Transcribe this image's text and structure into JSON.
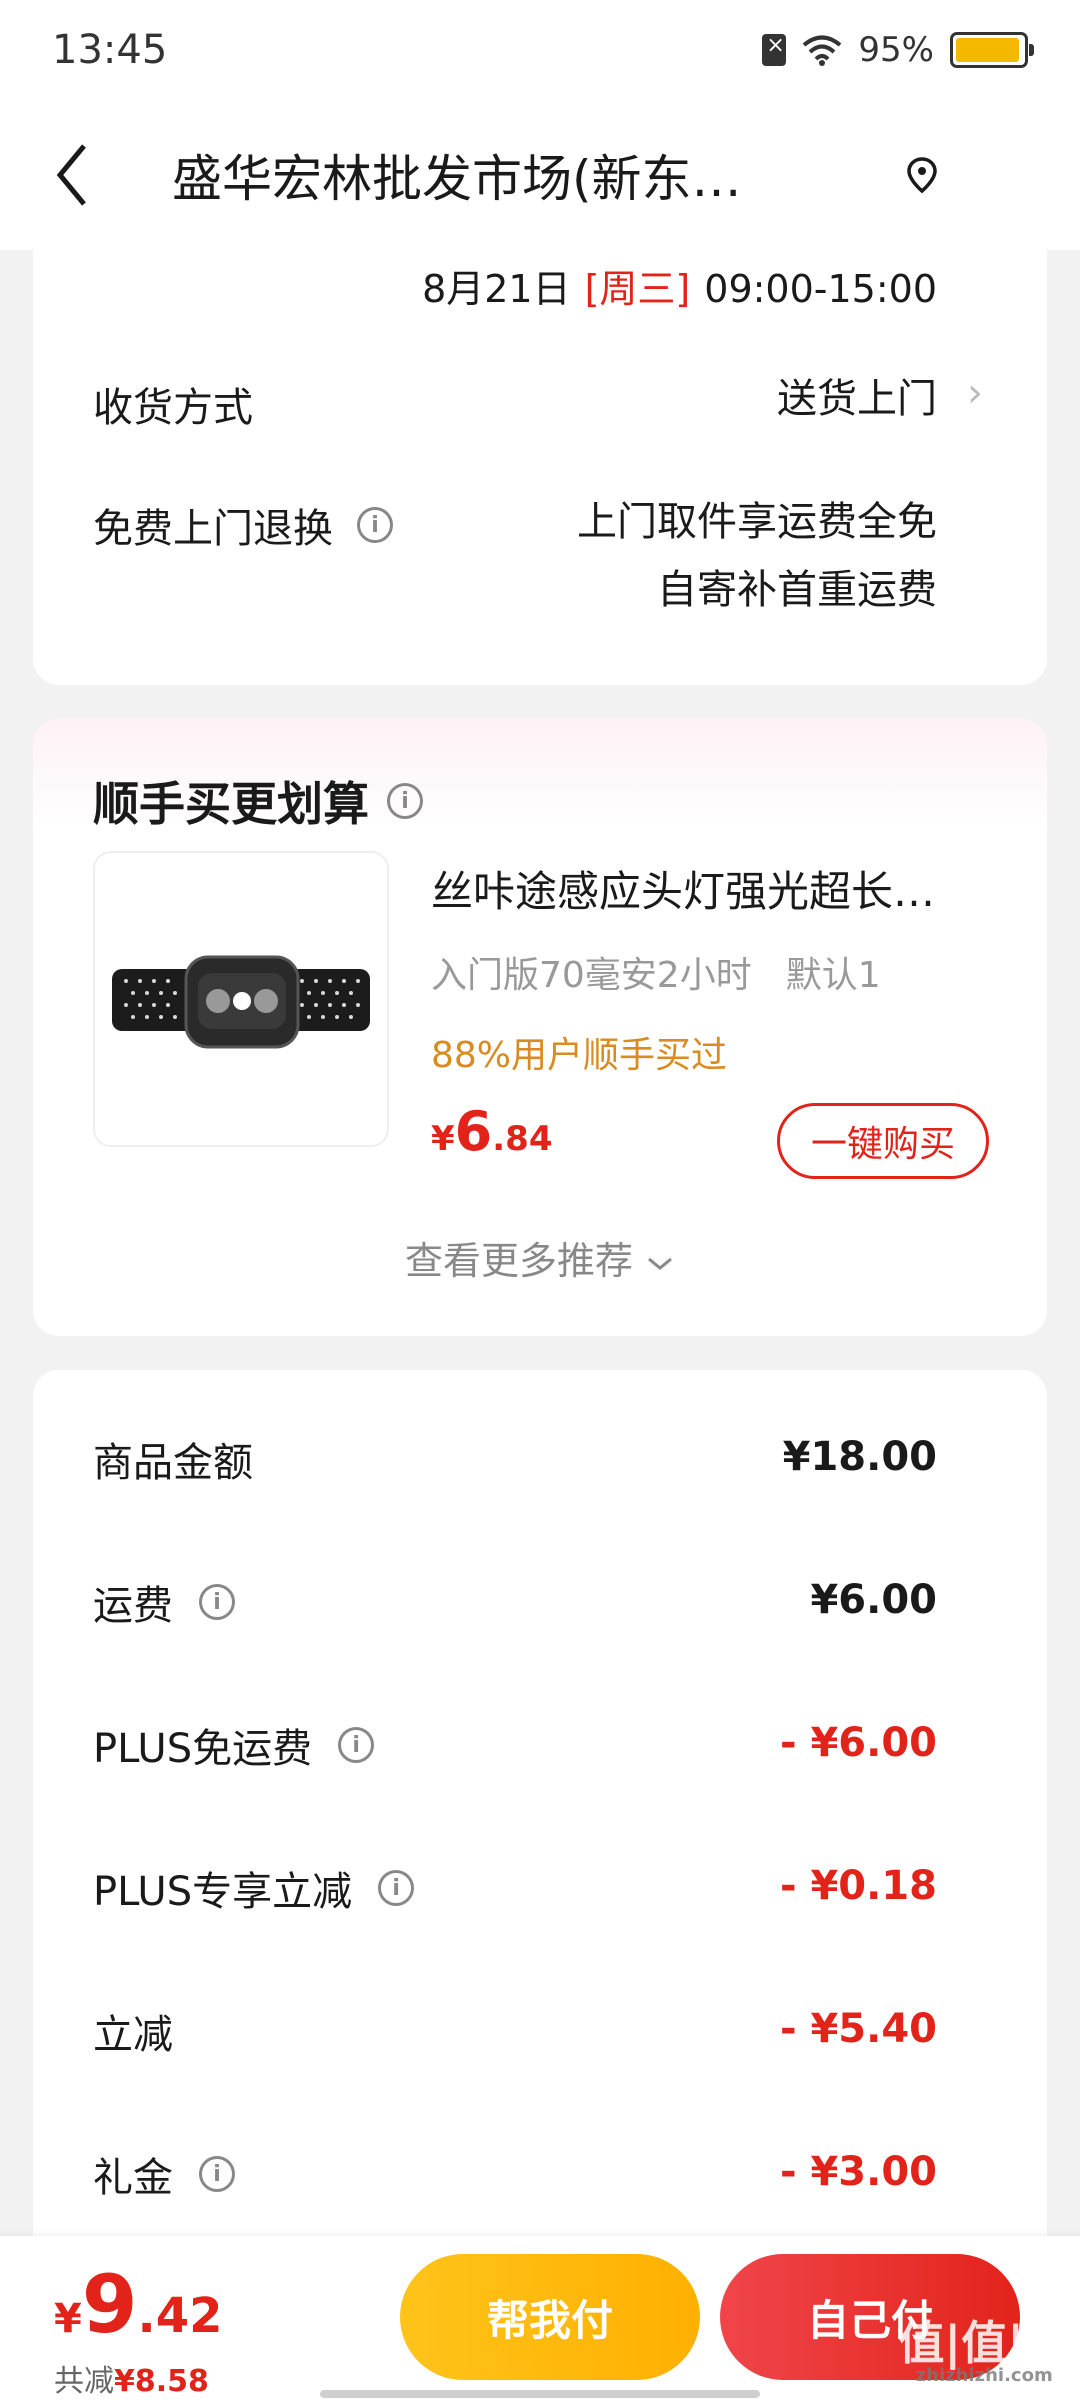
{
  "status_bar": {
    "time": "13:45",
    "battery": "95%",
    "battery_level": 0.95
  },
  "header": {
    "title": "盛华宏林批发市场(新东…"
  },
  "delivery": {
    "date": "8月21日",
    "weekday": "[周三]",
    "time_range": "09:00-15:00",
    "method_label": "收货方式",
    "method_value": "送货上门",
    "return_label": "免费上门退换",
    "return_value_line1": "上门取件享运费全免",
    "return_value_line2": "自寄补首重运费"
  },
  "recommend": {
    "title": "顺手买更划算",
    "product": {
      "name": "丝咔途感应头灯强光超长…",
      "spec": "入门版70毫安2小时",
      "variant": "默认1",
      "social_proof": "88%用户顺手买过",
      "price_currency": "¥",
      "price_int": "6",
      "price_dec": ".84",
      "buy_label": "一键购买"
    },
    "more_label": "查看更多推荐"
  },
  "fees": [
    {
      "label": "商品金额",
      "value": "¥18.00",
      "info": false,
      "discount": false
    },
    {
      "label": "运费",
      "value": "¥6.00",
      "info": true,
      "discount": false
    },
    {
      "label": "PLUS免运费",
      "value": "- ¥6.00",
      "info": true,
      "discount": true
    },
    {
      "label": "PLUS专享立减",
      "value": "- ¥0.18",
      "info": true,
      "discount": true
    },
    {
      "label": "立减",
      "value": "- ¥5.40",
      "info": false,
      "discount": true
    },
    {
      "label": "礼金",
      "value": "- ¥3.00",
      "info": true,
      "discount": true
    }
  ],
  "bottom": {
    "currency": "¥",
    "total_int": "9",
    "total_dec": ".42",
    "discount_label": "共减",
    "discount_amount": "¥8.58",
    "pay_friend_label": "帮我付",
    "pay_self_label": "自己付"
  },
  "watermark": {
    "text": "值|值|值",
    "site": "zhizhizhi.com"
  },
  "colors": {
    "accent_red": "#e2231a",
    "accent_orange": "#d98a20",
    "yellow_button": "#ffb800"
  }
}
